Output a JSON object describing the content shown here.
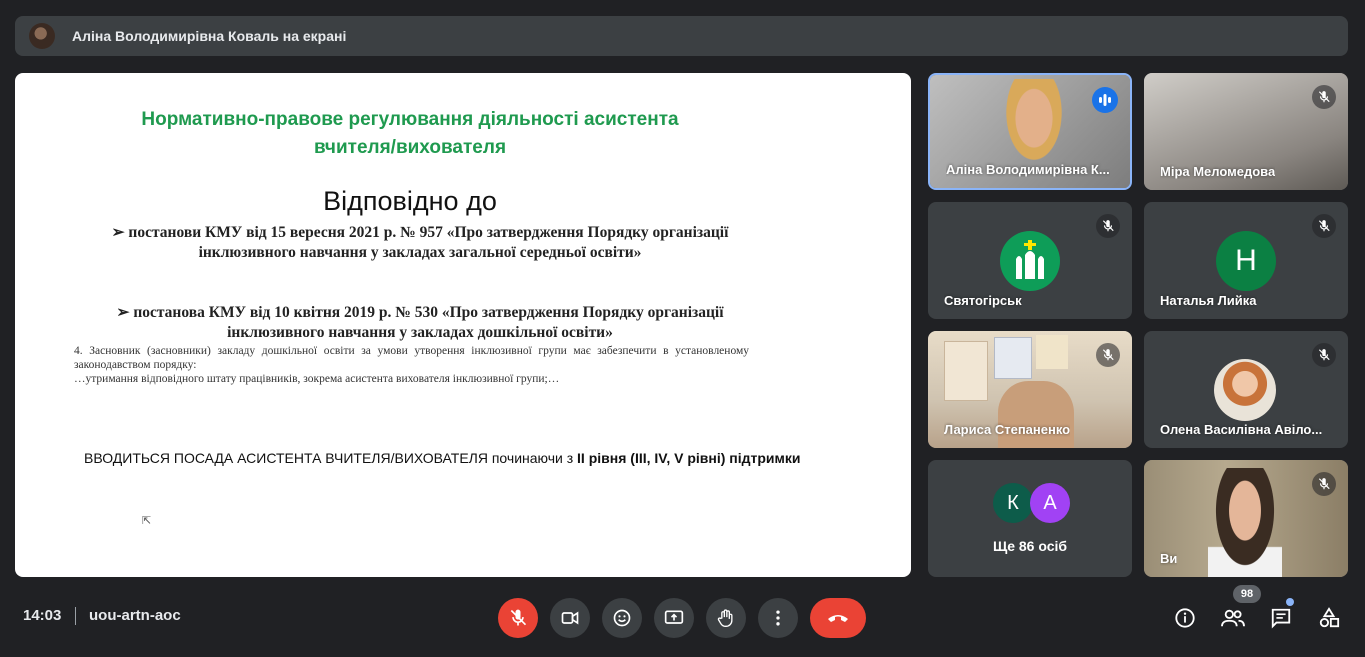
{
  "presenter_bar": {
    "title": "Аліна Володимирівна Коваль на екрані"
  },
  "slide": {
    "heading_line1": "Нормативно-правове регулювання діяльності асистента",
    "heading_line2": "вчителя/вихователя",
    "big_text": "Відповідно до",
    "bullet1_line1": "➢  постанови КМУ від 15 вересня 2021 р. № 957 «Про затвердження Порядку організації",
    "bullet1_line2": "інклюзивного навчання у закладах загальної середньої освіти»",
    "bullet2_line1": "➢  постанова КМУ від 10 квітня 2019 р. № 530 «Про затвердження Порядку організації",
    "bullet2_line2": "інклюзивного навчання у закладах дошкільної освіти»",
    "small_line1": "4. Засновник (засновники) закладу дошкільної освіти за умови утворення інклюзивної групи має забезпечити в установленому законодавством порядку:",
    "small_line2": "…утримання відповідного штату працівників, зокрема асистента вихователя інклюзивної групи;…",
    "intro_plain": "ВВОДИТЬСЯ ПОСАДА АСИСТЕНТА ВЧИТЕЛЯ/ВИХОВАТЕЛЯ починаючи з ",
    "intro_bold": " ІІ рівня (ІІІ, IV,  V рівні) підтримки"
  },
  "tiles": [
    {
      "name": "Аліна Володимирівна К...",
      "speaking": true
    },
    {
      "name": "Міра Меломедова"
    },
    {
      "name": "Святогірськ"
    },
    {
      "name": "Наталья Лийка",
      "initial": "Н",
      "color": "#0b8043"
    },
    {
      "name": "Лариса Степаненко"
    },
    {
      "name": "Олена Василівна Авіло..."
    },
    {
      "more_text": "Ще 86 осіб",
      "initials": [
        "К",
        "А"
      ],
      "colors": [
        "#0d5c4a",
        "#a142f4"
      ]
    },
    {
      "name": "Ви"
    }
  ],
  "bottom_bar": {
    "time": "14:03",
    "meeting_code": "uou-artn-aoc",
    "participants_count": "98",
    "icons": [
      "mic-off-icon",
      "camera-icon",
      "emoji-icon",
      "present-screen-icon",
      "raise-hand-icon",
      "more-vert-icon",
      "end-call-icon",
      "info-icon",
      "people-icon",
      "chat-icon",
      "activities-icon"
    ]
  },
  "colors": {
    "accent": "#8ab4f8",
    "danger": "#ea4335",
    "slide_heading": "#1f9a4f",
    "background": "#202124"
  }
}
